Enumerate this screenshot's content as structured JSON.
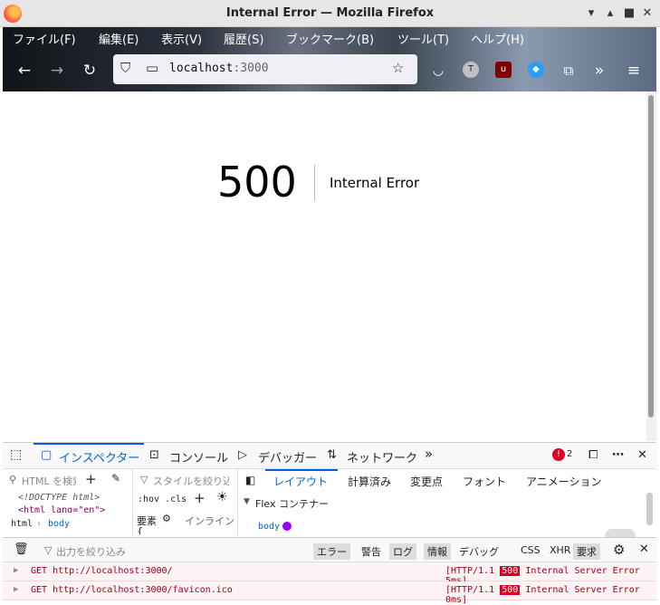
{
  "window": {
    "title": "Internal Error — Mozilla Firefox",
    "minimize_icon": "minimize-icon",
    "maximize_icon": "maximize-icon",
    "close_icon": "close-icon"
  },
  "menubar": {
    "items": [
      "ファイル(F)",
      "編集(E)",
      "表示(V)",
      "履歴(S)",
      "ブックマーク(B)",
      "ツール(T)",
      "ヘルプ(H)"
    ]
  },
  "toolbar": {
    "url_host": "localhost",
    "url_port": ":3000"
  },
  "page": {
    "error_code": "500",
    "error_message": "Internal Error"
  },
  "devtools": {
    "tabs": [
      "インスペクター",
      "コンソール",
      "デバッガー",
      "ネットワーク"
    ],
    "error_count": "2",
    "html_search_placeholder": "HTML を検索",
    "doctype": "<!DOCTYPE html>",
    "html_tag": "<html lang=\"en\">",
    "breadcrumb_html": "html",
    "breadcrumb_body": "body",
    "styles_filter_placeholder": "スタイルを絞り込み",
    "hov_cls": ":hov .cls",
    "element_label": "要素",
    "inline_label": "インライン",
    "brace": "{",
    "layout_tabs": [
      "レイアウト",
      "計算済み",
      "変更点",
      "フォント",
      "アニメーション"
    ],
    "flex_container": "Flex コンテナー",
    "flex_body": "body"
  },
  "console": {
    "filter_placeholder": "出力を絞り込み",
    "filters": [
      "エラー",
      "警告",
      "ログ",
      "情報",
      "デバッグ"
    ],
    "types": [
      "CSS",
      "XHR",
      "要求"
    ],
    "rows": [
      {
        "method": "GET",
        "url": "http://localhost:3000/",
        "proto": "[HTTP/1.1",
        "code": "500",
        "text": "Internal Server Error 5ms]"
      },
      {
        "method": "GET",
        "url": "http://localhost:3000/favicon.ico",
        "proto": "[HTTP/1.1",
        "code": "500",
        "text": "Internal Server Error 0ms]"
      }
    ]
  },
  "colors": {
    "accent": "#0060df",
    "error": "#d70022"
  }
}
